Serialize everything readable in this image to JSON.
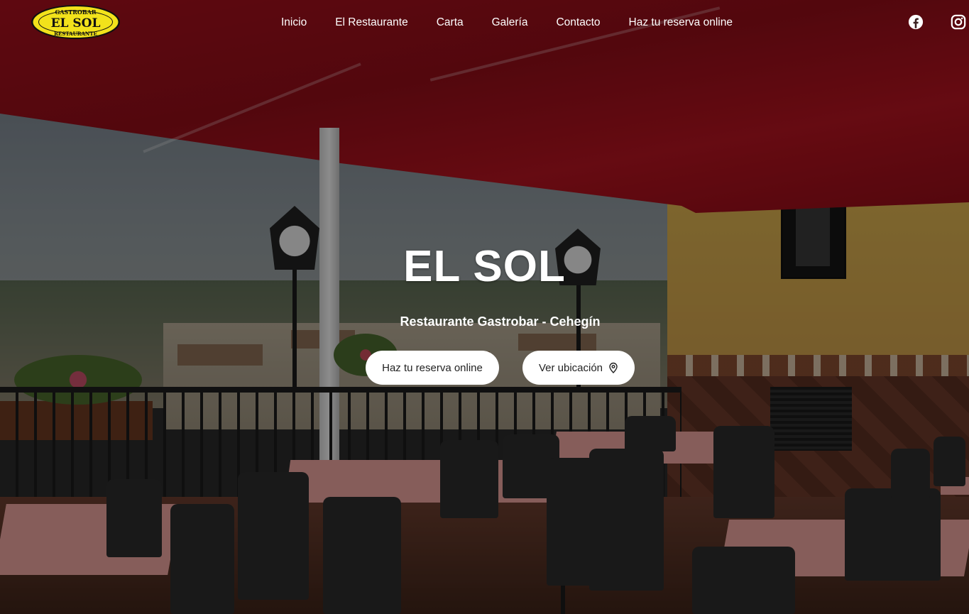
{
  "brand": {
    "logo_top": "GASTROBAR",
    "logo_main": "EL SOL",
    "logo_bottom": "RESTAURANTE"
  },
  "nav": {
    "items": [
      {
        "label": "Inicio"
      },
      {
        "label": "El Restaurante"
      },
      {
        "label": "Carta"
      },
      {
        "label": "Galería"
      },
      {
        "label": "Contacto"
      },
      {
        "label": "Haz tu reserva online"
      }
    ]
  },
  "social": {
    "facebook_icon": "facebook-icon",
    "instagram_icon": "instagram-icon"
  },
  "hero": {
    "title": "EL SOL",
    "subtitle": "Restaurante Gastrobar - Cehegín",
    "reserve_button": "Haz tu reserva online",
    "location_button": "Ver ubicación",
    "location_icon": "map-pin-icon"
  },
  "colors": {
    "awning": "#a30f1c",
    "button_bg": "#ffffff",
    "logo_yellow": "#f2e21b"
  }
}
